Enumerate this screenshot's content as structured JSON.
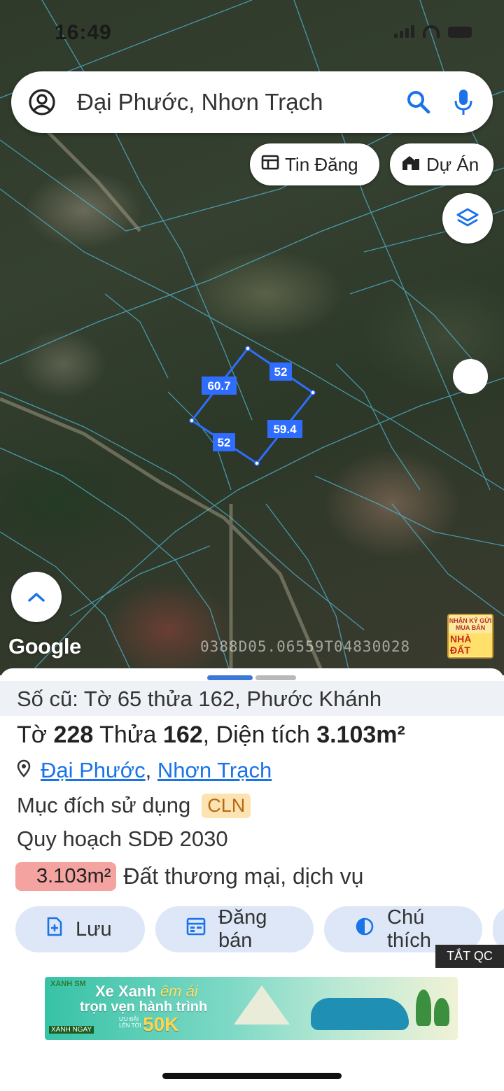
{
  "status_bar": {
    "time": "16:49"
  },
  "search": {
    "text": "Đại Phước, Nhơn Trạch"
  },
  "chips": {
    "listings": "Tin Đăng",
    "projects": "Dự Án"
  },
  "map": {
    "google_label": "Google",
    "watermark": "0388D05.06559T04830028",
    "brand_badge_line": "NHẬN KÝ GỬI MUA BÁN",
    "brand_badge_name": "NHÀ ĐẤT",
    "plot_edges": [
      "60.7",
      "52",
      "59.4",
      "52"
    ],
    "parcel_color": "#2f6dff"
  },
  "sheet": {
    "old_record": "Số cũ: Tờ 65 thửa 162, Phước Khánh",
    "title_sheet_label": "Tờ",
    "title_sheet_num": "228",
    "title_lot_label": "Thửa",
    "title_lot_num": "162",
    "title_area_label": ", Diện tích",
    "title_area": "3.103m²",
    "location_ward": "Đại Phước",
    "location_sep": ",",
    "location_district": "Nhơn Trạch",
    "purpose_label": "Mục đích sử dụng",
    "purpose_code": "CLN",
    "plan_label": "Quy hoạch SDĐ 2030",
    "zone_area": "3.103m²",
    "zone_type": "Đất thương mại, dịch vụ",
    "actions": {
      "save": "Lưu",
      "post": "Đăng bán",
      "legend": "Chú thích"
    },
    "ads_off": "TẮT QC"
  },
  "banner": {
    "brand": "XANH SM",
    "line1_a": "Xe Xanh",
    "line1_b": "êm ái",
    "line2": "trọn vẹn hành trình",
    "sub": "XANH NGAY",
    "deal_a": "ƯU ĐÃI",
    "deal_b": "LÊN TỚI",
    "amount": "50K"
  }
}
